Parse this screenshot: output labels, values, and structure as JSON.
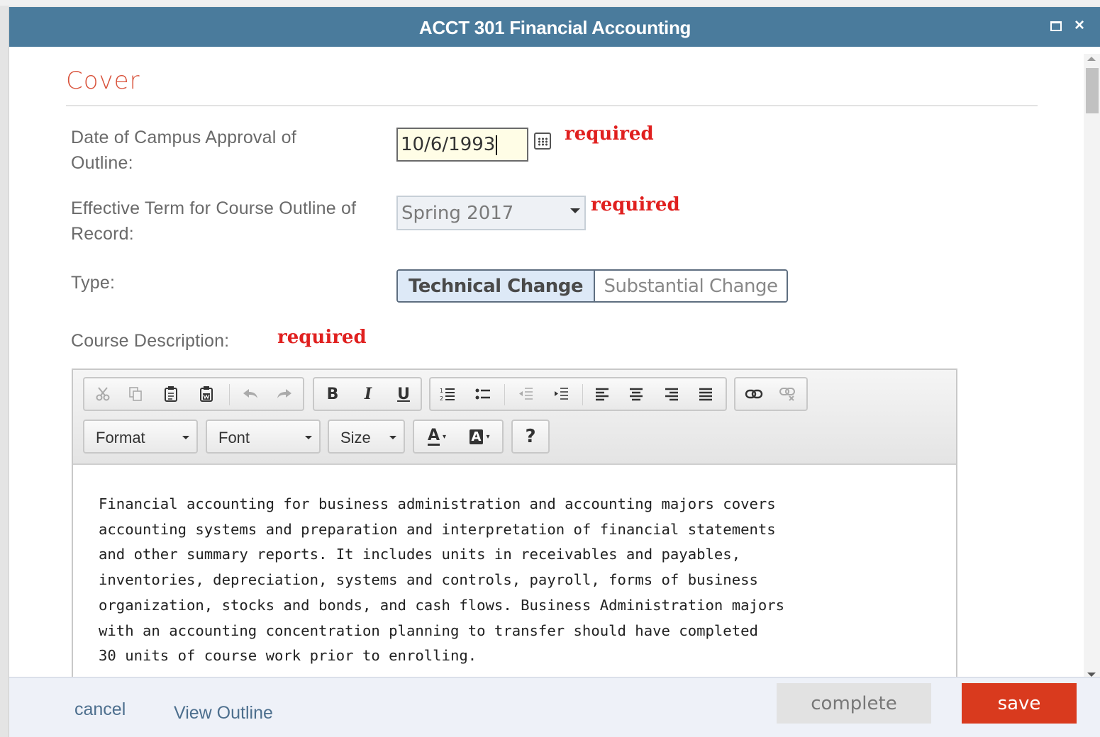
{
  "dialog": {
    "title": "ACCT 301 Financial Accounting",
    "maximize_icon": "maximize-icon",
    "close_glyph": "×"
  },
  "section": {
    "title": "Cover"
  },
  "fields": {
    "approval_date": {
      "label": "Date of Campus Approval of Outline:",
      "value": "10/6/1993",
      "required": "required"
    },
    "effective_term": {
      "label": "Effective Term for Course Outline of Record:",
      "value": "Spring 2017",
      "required": "required"
    },
    "type": {
      "label": "Type:",
      "options": [
        "Technical Change",
        "Substantial Change"
      ],
      "selected": "Technical Change"
    },
    "course_description": {
      "label": "Course Description:",
      "required": "required",
      "text": "Financial accounting for business administration and accounting majors covers\naccounting systems and preparation and interpretation of financial statements\nand other summary reports. It includes units in receivables and payables,\ninventories, depreciation, systems and controls, payroll, forms of business\norganization, stocks and bonds, and cash flows. Business Administration majors\nwith an accounting concentration planning to transfer should have completed\n30 units of course work prior to enrolling."
    }
  },
  "editor_toolbar": {
    "bold": "B",
    "italic": "I",
    "underline": "U",
    "format": "Format",
    "font": "Font",
    "size": "Size",
    "text_color": "A",
    "bg_color": "A",
    "help": "?"
  },
  "footer": {
    "cancel": "cancel",
    "view_outline": "View Outline",
    "complete": "complete",
    "save": "save"
  },
  "colors": {
    "titlebar": "#4a7b9c",
    "required": "#e0201f",
    "section_title": "#d9533c",
    "save": "#d93a1e"
  }
}
